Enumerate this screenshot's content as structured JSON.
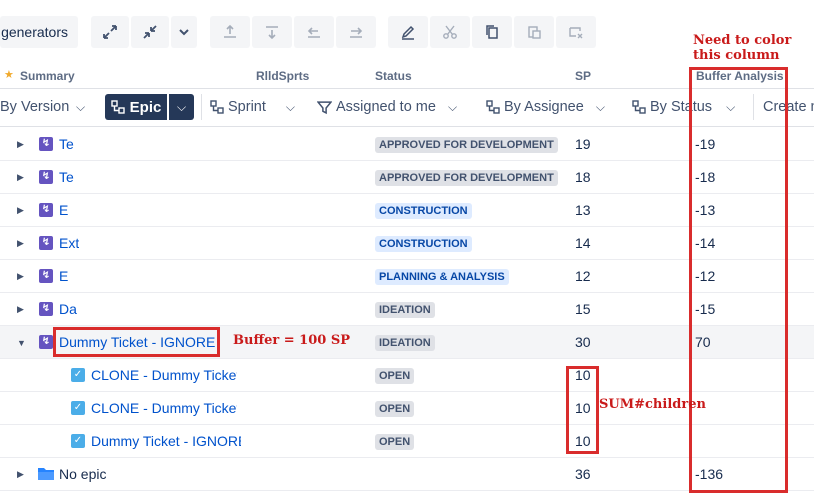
{
  "toolbar": {
    "generators_label": "generators",
    "icons": [
      "expand-icon",
      "collapse-icon",
      "chevron-down-icon",
      "move-top-icon",
      "move-down-icon",
      "outdent-icon",
      "indent-icon",
      "edit-icon",
      "cut-icon",
      "copy-icon",
      "paste-icon",
      "remove-icon"
    ]
  },
  "columns": {
    "summary": "Summary",
    "rlld": "RlldSprts",
    "status": "Status",
    "sp": "SP",
    "buffer": "Buffer Analysis"
  },
  "group_by": {
    "version": "By Version",
    "epic": "Epic",
    "sprint": "Sprint",
    "assigned": "Assigned to me",
    "assignee": "By Assignee",
    "status": "By Status",
    "create": "Create n"
  },
  "rows": [
    {
      "summary": "Te",
      "status": "APPROVED FOR DEVELOPMENT",
      "sp": "19",
      "buffer": "-19"
    },
    {
      "summary": "Te",
      "status": "APPROVED FOR DEVELOPMENT",
      "sp": "18",
      "buffer": "-18"
    },
    {
      "summary": "E",
      "status": "CONSTRUCTION",
      "sp": "13",
      "buffer": "-13"
    },
    {
      "summary": "Ext",
      "status": "CONSTRUCTION",
      "sp": "14",
      "buffer": "-14"
    },
    {
      "summary": "E",
      "status": "PLANNING & ANALYSIS",
      "sp": "12",
      "buffer": "-12"
    },
    {
      "summary": "Da",
      "status": "IDEATION",
      "sp": "15",
      "buffer": "-15"
    },
    {
      "summary": "Dummy Ticket - IGNORE",
      "status": "IDEATION",
      "sp": "30",
      "buffer": "70"
    },
    {
      "summary": "CLONE - Dummy Ticket",
      "status": "OPEN",
      "sp": "10",
      "buffer": ""
    },
    {
      "summary": "CLONE - Dummy Ticket",
      "status": "OPEN",
      "sp": "10",
      "buffer": ""
    },
    {
      "summary": "Dummy Ticket - IGNORE",
      "status": "OPEN",
      "sp": "10",
      "buffer": ""
    },
    {
      "summary": "No epic",
      "status": "",
      "sp": "36",
      "buffer": "-136"
    }
  ],
  "annotations": {
    "color_note_line1": "Need to color",
    "color_note_line2": "this column",
    "buffer_note": "Buffer = 100 SP",
    "sum_note": "SUM#children"
  },
  "colors": {
    "epic": "#6554c0",
    "task": "#4bade8",
    "annotation": "#d92c2c",
    "group_active": "#253858"
  }
}
